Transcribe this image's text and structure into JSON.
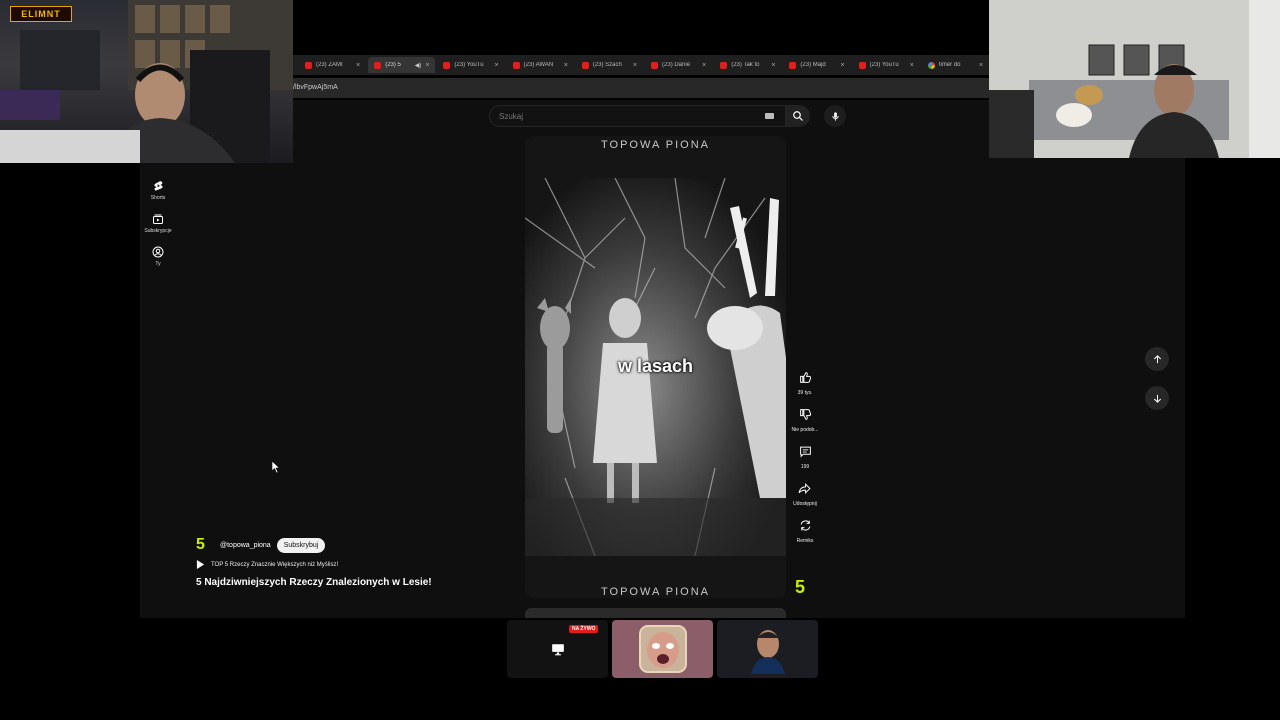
{
  "browser": {
    "tabs": [
      {
        "label": "(23) ZAMI",
        "active": false,
        "icon": "youtube-icon"
      },
      {
        "label": "(23) 5",
        "active": true,
        "icon": "youtube-icon",
        "audio": true
      },
      {
        "label": "(23) YouTu",
        "active": false,
        "icon": "youtube-icon"
      },
      {
        "label": "(23) AWAN",
        "active": false,
        "icon": "youtube-icon"
      },
      {
        "label": "(23) Szach",
        "active": false,
        "icon": "youtube-icon"
      },
      {
        "label": "(23) Danie",
        "active": false,
        "icon": "youtube-icon"
      },
      {
        "label": "(23) Tak to",
        "active": false,
        "icon": "youtube-icon"
      },
      {
        "label": "(23) Majd",
        "active": false,
        "icon": "youtube-icon"
      },
      {
        "label": "(23) YouTu",
        "active": false,
        "icon": "youtube-icon"
      },
      {
        "label": "timer do",
        "active": false,
        "icon": "google-icon"
      }
    ],
    "url_fragment": "/lbvFpwAj5mA"
  },
  "header": {
    "search_placeholder": "Szukaj"
  },
  "sidebar": {
    "items": [
      {
        "label": "Shorts",
        "icon": "shorts-icon"
      },
      {
        "label": "Subskrypcje",
        "icon": "subscriptions-icon"
      },
      {
        "label": "Ty",
        "icon": "you-icon"
      }
    ]
  },
  "short": {
    "brand_top": "TOPOWA PIONA",
    "brand_bottom": "TOPOWA PIONA",
    "caption": "w lasach"
  },
  "actions": {
    "like_count": "39 tys.",
    "dislike_label": "Nie podob...",
    "comments_count": "199",
    "share_label": "Udostępnij",
    "remix_label": "Remiks",
    "channel_badge": "5"
  },
  "channel": {
    "logo": "5",
    "handle": "@topowa_piona",
    "subscribe_label": "Subskrybuj",
    "playlist_title": "TOP 5 Rzeczy Znacznie Większych niż Myślisz!",
    "video_title": "5 Najdziwniejszych Rzeczy Znalezionych w Lesie!"
  },
  "stream": {
    "logo_text": "ELIMNT",
    "live_label": "NA ŻYWO"
  },
  "colors": {
    "youtube_red": "#e02020",
    "channel_accent": "#c8f000",
    "live_red": "#e21b1b",
    "page_bg": "#0f0f0f"
  }
}
